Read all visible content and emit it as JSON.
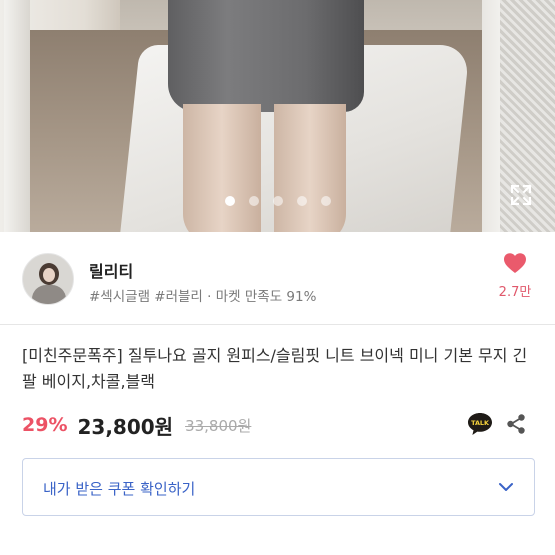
{
  "product_image": {
    "alt": "gray knit mini skirt on model in mirror",
    "slide_count": 5,
    "active_slide": 1,
    "expand_icon": "expand-icon"
  },
  "seller": {
    "name": "릴리티",
    "tags": "#섹시글램 #러블리",
    "satisfaction": "· 마켓 만족도 91%",
    "avatar": "avatar-icon",
    "like_count": "2.7만",
    "like_icon": "heart-icon",
    "like_color": "#ea5a6c"
  },
  "product": {
    "title": "[미친주문폭주] 질투나요 골지 원피스/슬림핏 니트 브이넥 미니 기본 무지 긴팔 베이지,차콜,블랙",
    "discount": "29%",
    "price": "23,800원",
    "original_price": "33,800원",
    "discount_color": "#ec5265"
  },
  "actions": {
    "kakao_label": "TALK",
    "kakao_icon": "kakaotalk-icon",
    "share_icon": "share-icon"
  },
  "coupon": {
    "label": "내가 받은 쿠폰 확인하기",
    "chevron_icon": "chevron-down-icon",
    "accent": "#3a63c7"
  }
}
